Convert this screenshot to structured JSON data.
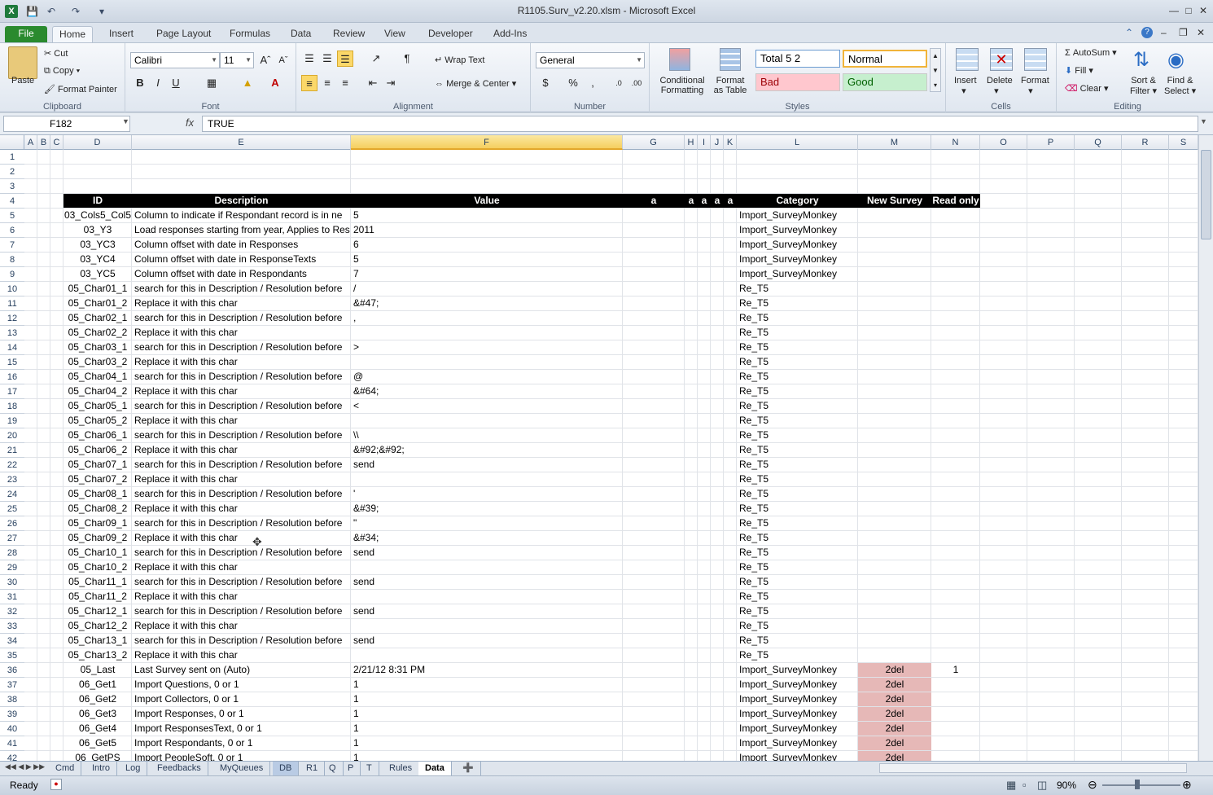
{
  "window": {
    "title": "R1105.Surv_v2.20.xlsm - Microsoft Excel"
  },
  "tabs": [
    "File",
    "Home",
    "Insert",
    "Page Layout",
    "Formulas",
    "Data",
    "Review",
    "View",
    "Developer",
    "Add-Ins"
  ],
  "ribbon": {
    "clipboard": {
      "label": "Clipboard",
      "paste": "Paste",
      "cut": "Cut",
      "copy": "Copy",
      "format_painter": "Format Painter"
    },
    "font": {
      "label": "Font",
      "name": "Calibri",
      "size": "11"
    },
    "alignment": {
      "label": "Alignment",
      "wrap_text": "Wrap Text",
      "merge_center": "Merge & Center"
    },
    "number": {
      "label": "Number",
      "format": "General"
    },
    "styles": {
      "label": "Styles",
      "conditional": "Conditional",
      "conditional2": "Formatting",
      "format_table": "Format",
      "format_table2": "as Table",
      "total": "Total 5 2",
      "normal": "Normal",
      "bad": "Bad",
      "good": "Good"
    },
    "cells": {
      "label": "Cells",
      "insert": "Insert",
      "delete": "Delete",
      "format": "Format"
    },
    "editing": {
      "label": "Editing",
      "autosum": "AutoSum",
      "fill": "Fill",
      "clear": "Clear",
      "sort": "Sort &",
      "sort2": "Filter",
      "find": "Find &",
      "find2": "Select"
    }
  },
  "formula_bar": {
    "name_box": "F182",
    "fx": "fx",
    "value": "TRUE"
  },
  "columns": [
    "A",
    "B",
    "C",
    "D",
    "E",
    "F",
    "G",
    "H",
    "I",
    "J",
    "K",
    "L",
    "M",
    "N",
    "O",
    "P",
    "Q",
    "R",
    "S"
  ],
  "header_row": {
    "id": "ID",
    "description": "Description",
    "value": "Value",
    "g": "a",
    "h": "a",
    "i": "a",
    "j": "a",
    "k": "a",
    "category": "Category",
    "new_survey": "New Survey",
    "read_only": "Read only"
  },
  "rows": [
    {
      "n": "1"
    },
    {
      "n": "2"
    },
    {
      "n": "3"
    },
    {
      "n": "4",
      "header": true
    },
    {
      "n": "5",
      "id": "03_Cols5_Col5",
      "desc": "Column to indicate if Respondant record is in ne",
      "val": "5",
      "cat": "Import_SurveyMonkey"
    },
    {
      "n": "6",
      "id": "03_Y3",
      "desc": "Load responses starting from year, Applies to Res",
      "val": "2011",
      "cat": "Import_SurveyMonkey"
    },
    {
      "n": "7",
      "id": "03_YC3",
      "desc": "Column offset with date in Responses",
      "val": "6",
      "cat": "Import_SurveyMonkey"
    },
    {
      "n": "8",
      "id": "03_YC4",
      "desc": "Column offset with date in ResponseTexts",
      "val": "5",
      "cat": "Import_SurveyMonkey"
    },
    {
      "n": "9",
      "id": "03_YC5",
      "desc": "Column offset with date in Respondants",
      "val": "7",
      "cat": "Import_SurveyMonkey"
    },
    {
      "n": "10",
      "id": "05_Char01_1",
      "desc": "search for this in Description / Resolution before",
      "val": "/",
      "cat": "Re_T5"
    },
    {
      "n": "11",
      "id": "05_Char01_2",
      "desc": "Replace it with this char",
      "val": "&#47;",
      "cat": "Re_T5"
    },
    {
      "n": "12",
      "id": "05_Char02_1",
      "desc": "search for this in Description / Resolution before",
      "val": ",",
      "cat": "Re_T5"
    },
    {
      "n": "13",
      "id": "05_Char02_2",
      "desc": "Replace it with this char",
      "val": "",
      "cat": "Re_T5"
    },
    {
      "n": "14",
      "id": "05_Char03_1",
      "desc": "search for this in Description / Resolution before",
      "val": ">",
      "cat": "Re_T5"
    },
    {
      "n": "15",
      "id": "05_Char03_2",
      "desc": "Replace it with this char",
      "val": "",
      "cat": "Re_T5"
    },
    {
      "n": "16",
      "id": "05_Char04_1",
      "desc": "search for this in Description / Resolution before",
      "val": "@",
      "cat": "Re_T5"
    },
    {
      "n": "17",
      "id": "05_Char04_2",
      "desc": "Replace it with this char",
      "val": "&#64;",
      "cat": "Re_T5"
    },
    {
      "n": "18",
      "id": "05_Char05_1",
      "desc": "search for this in Description / Resolution before",
      "val": "<",
      "cat": "Re_T5"
    },
    {
      "n": "19",
      "id": "05_Char05_2",
      "desc": "Replace it with this char",
      "val": "",
      "cat": "Re_T5"
    },
    {
      "n": "20",
      "id": "05_Char06_1",
      "desc": "search for this in Description / Resolution before",
      "val": "\\\\",
      "cat": "Re_T5"
    },
    {
      "n": "21",
      "id": "05_Char06_2",
      "desc": "Replace it with this char",
      "val": "&#92;&#92;",
      "cat": "Re_T5"
    },
    {
      "n": "22",
      "id": "05_Char07_1",
      "desc": "search for this in Description / Resolution before",
      "val": "send",
      "cat": "Re_T5"
    },
    {
      "n": "23",
      "id": "05_Char07_2",
      "desc": "Replace it with this char",
      "val": "",
      "cat": "Re_T5"
    },
    {
      "n": "24",
      "id": "05_Char08_1",
      "desc": "search for this in Description / Resolution before",
      "val": "'",
      "cat": "Re_T5"
    },
    {
      "n": "25",
      "id": "05_Char08_2",
      "desc": "Replace it with this char",
      "val": "&#39;",
      "cat": "Re_T5"
    },
    {
      "n": "26",
      "id": "05_Char09_1",
      "desc": "search for this in Description / Resolution before",
      "val": "\"",
      "cat": "Re_T5"
    },
    {
      "n": "27",
      "id": "05_Char09_2",
      "desc": "Replace it with this char",
      "val": "&#34;",
      "cat": "Re_T5"
    },
    {
      "n": "28",
      "id": "05_Char10_1",
      "desc": "search for this in Description / Resolution before",
      "val": "send",
      "cat": "Re_T5"
    },
    {
      "n": "29",
      "id": "05_Char10_2",
      "desc": "Replace it with this char",
      "val": "",
      "cat": "Re_T5"
    },
    {
      "n": "30",
      "id": "05_Char11_1",
      "desc": "search for this in Description / Resolution before",
      "val": "send",
      "cat": "Re_T5"
    },
    {
      "n": "31",
      "id": "05_Char11_2",
      "desc": "Replace it with this char",
      "val": "",
      "cat": "Re_T5"
    },
    {
      "n": "32",
      "id": "05_Char12_1",
      "desc": "search for this in Description / Resolution before",
      "val": "send",
      "cat": "Re_T5"
    },
    {
      "n": "33",
      "id": "05_Char12_2",
      "desc": "Replace it with this char",
      "val": "",
      "cat": "Re_T5"
    },
    {
      "n": "34",
      "id": "05_Char13_1",
      "desc": "search for this in Description / Resolution before",
      "val": "send",
      "cat": "Re_T5"
    },
    {
      "n": "35",
      "id": "05_Char13_2",
      "desc": "Replace it with this char",
      "val": "",
      "cat": "Re_T5"
    },
    {
      "n": "36",
      "id": "05_Last",
      "desc": "Last Survey sent on (Auto)",
      "val": "2/21/12 8:31 PM",
      "cat": "Import_SurveyMonkey",
      "ns": "2del",
      "ro": "1"
    },
    {
      "n": "37",
      "id": "06_Get1",
      "desc": "Import Questions, 0 or 1",
      "val": "1",
      "cat": "Import_SurveyMonkey",
      "ns": "2del"
    },
    {
      "n": "38",
      "id": "06_Get2",
      "desc": "Import Collectors, 0 or 1",
      "val": "1",
      "cat": "Import_SurveyMonkey",
      "ns": "2del"
    },
    {
      "n": "39",
      "id": "06_Get3",
      "desc": "Import Responses, 0 or 1",
      "val": "1",
      "cat": "Import_SurveyMonkey",
      "ns": "2del"
    },
    {
      "n": "40",
      "id": "06_Get4",
      "desc": "Import ResponsesText, 0 or 1",
      "val": "1",
      "cat": "Import_SurveyMonkey",
      "ns": "2del"
    },
    {
      "n": "41",
      "id": "06_Get5",
      "desc": "Import Respondants, 0 or 1",
      "val": "1",
      "cat": "Import_SurveyMonkey",
      "ns": "2del"
    },
    {
      "n": "42",
      "id": "06_GetPS",
      "desc": "Import PeopleSoft, 0 or 1",
      "val": "1",
      "cat": "Import_SurveyMonkey",
      "ns": "2del"
    }
  ],
  "sheet_tabs": [
    "Cmd",
    "Intro",
    "Log",
    "Feedbacks",
    "MyQueues",
    "DB",
    "R1",
    "Q",
    "P",
    "T",
    "Rules",
    "Data"
  ],
  "active_sheet": "Data",
  "status": {
    "ready": "Ready",
    "zoom": "90%"
  },
  "colors": {
    "header_bg": "#000000",
    "bad_fill": "#e6b8b7",
    "selected_col": "#f5cf5f"
  }
}
